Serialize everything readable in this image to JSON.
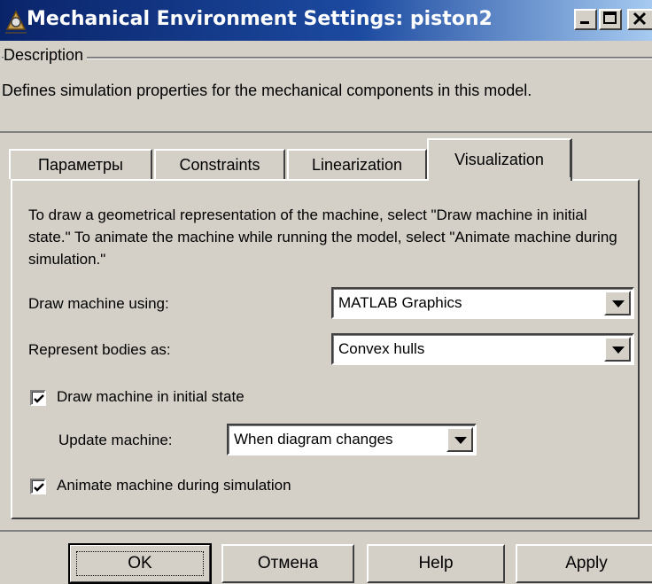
{
  "window": {
    "title": "Mechanical Environment Settings: piston2",
    "minimize": "_",
    "maximize": "□",
    "close": "X"
  },
  "description": {
    "group_label": "Description",
    "text": "Defines simulation properties for the mechanical components in this model."
  },
  "tabs": [
    {
      "label": "Параметры"
    },
    {
      "label": "Constraints"
    },
    {
      "label": "Linearization"
    },
    {
      "label": "Visualization",
      "active": true
    }
  ],
  "visualization": {
    "info": "To draw a geometrical representation of the machine, select \"Draw machine in initial state.\" To animate the machine while running the model, select \"Animate machine during simulation.\"",
    "draw_using": {
      "label": "Draw machine using:",
      "value": "MATLAB Graphics"
    },
    "represent_bodies": {
      "label": "Represent bodies as:",
      "value": "Convex hulls"
    },
    "draw_initial": {
      "label": "Draw machine in initial state",
      "checked": true
    },
    "update_machine": {
      "label": "Update machine:",
      "value": "When diagram changes"
    },
    "animate": {
      "label": "Animate machine during simulation",
      "checked": true
    }
  },
  "buttons": {
    "ok": "OK",
    "cancel": "Отмена",
    "help": "Help",
    "apply": "Apply"
  },
  "icons": {
    "title_icon": "simmechanics-icon",
    "dropdown": "chevron-down-icon",
    "check": "checkmark-icon"
  }
}
